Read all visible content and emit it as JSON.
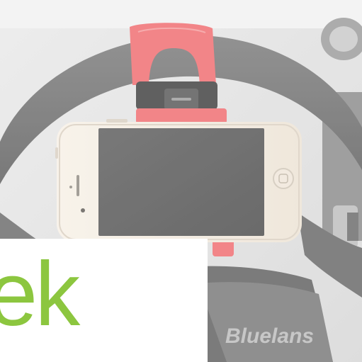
{
  "image": {
    "description_colors": {
      "background": "#f2f2f2",
      "steering_wheel": "#6f6f6f",
      "mount_red": "#ef6b6e",
      "phone_body": "#f4ebe0",
      "phone_screen": "#545454",
      "text_green": "#8cc63f"
    }
  },
  "overlay": {
    "text": "ek"
  },
  "watermark": {
    "text": "Bluelans"
  }
}
